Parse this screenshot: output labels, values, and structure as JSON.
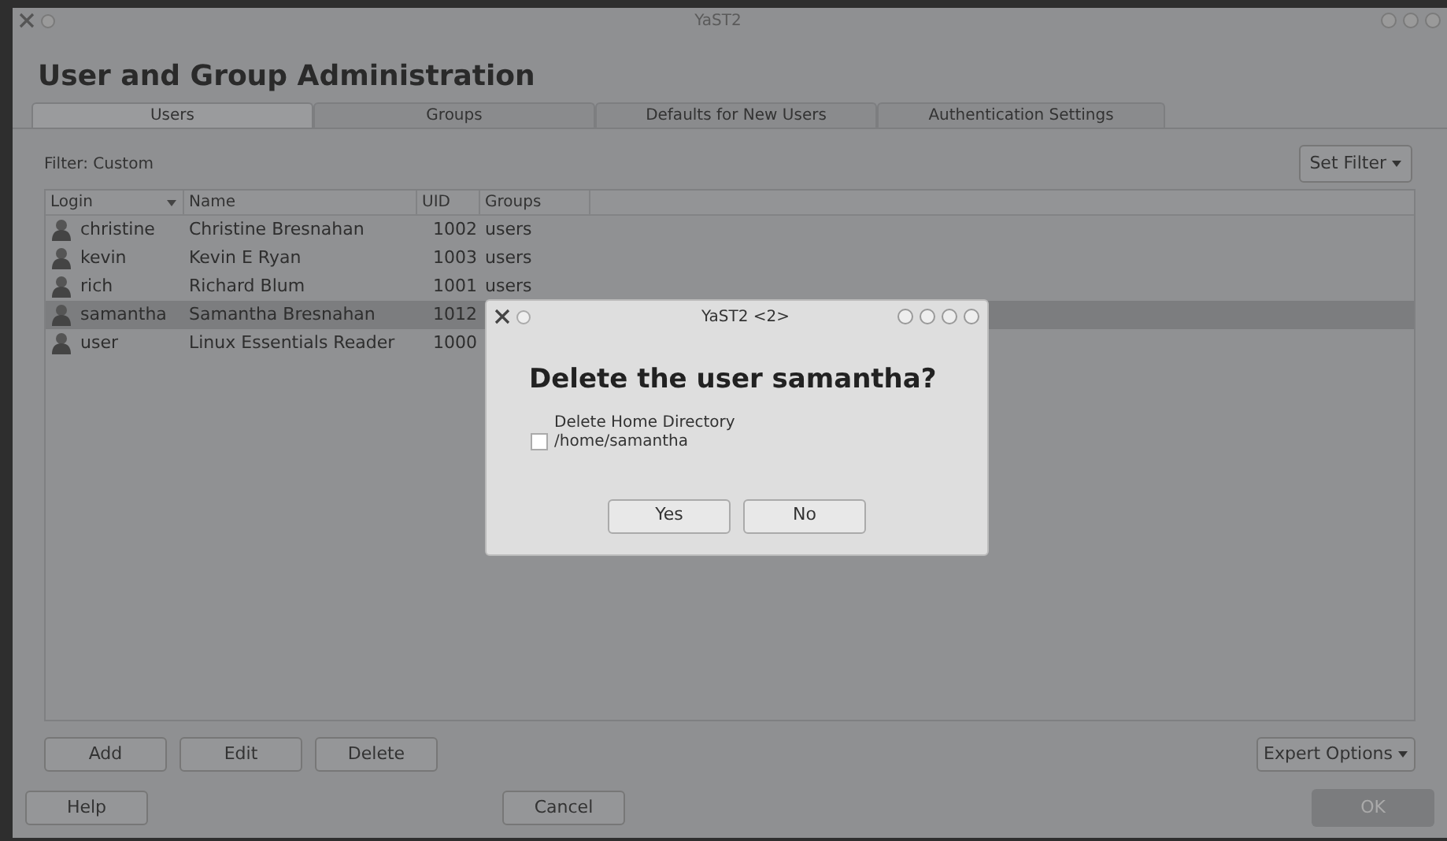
{
  "window": {
    "title": "YaST2"
  },
  "heading": "User and Group Administration",
  "tabs": [
    {
      "label": "Users",
      "selected": true
    },
    {
      "label": "Groups",
      "selected": false
    },
    {
      "label": "Defaults for New Users",
      "selected": false
    },
    {
      "label": "Authentication Settings",
      "selected": false
    }
  ],
  "filter": {
    "label": "Filter: Custom",
    "button": "Set Filter"
  },
  "table": {
    "columns": [
      "Login",
      "Name",
      "UID",
      "Groups"
    ],
    "rows": [
      {
        "login": "christine",
        "name": "Christine Bresnahan",
        "uid": "1002",
        "groups": "users",
        "selected": false
      },
      {
        "login": "kevin",
        "name": "Kevin E Ryan",
        "uid": "1003",
        "groups": "users",
        "selected": false
      },
      {
        "login": "rich",
        "name": "Richard Blum",
        "uid": "1001",
        "groups": "users",
        "selected": false
      },
      {
        "login": "samantha",
        "name": "Samantha Bresnahan",
        "uid": "1012",
        "selected": true
      },
      {
        "login": "user",
        "name": "Linux Essentials Reader",
        "uid": "1000",
        "selected": false
      }
    ]
  },
  "actions": [
    "Add",
    "Edit",
    "Delete"
  ],
  "expert_button": "Expert Options",
  "footer": {
    "help": "Help",
    "cancel": "Cancel",
    "ok": "OK"
  },
  "dialog": {
    "title": "YaST2 <2>",
    "question": "Delete the user samantha?",
    "checkbox": {
      "label": "Delete Home Directory",
      "path": "/home/samantha",
      "checked": false
    },
    "buttons": [
      "Yes",
      "No"
    ]
  }
}
